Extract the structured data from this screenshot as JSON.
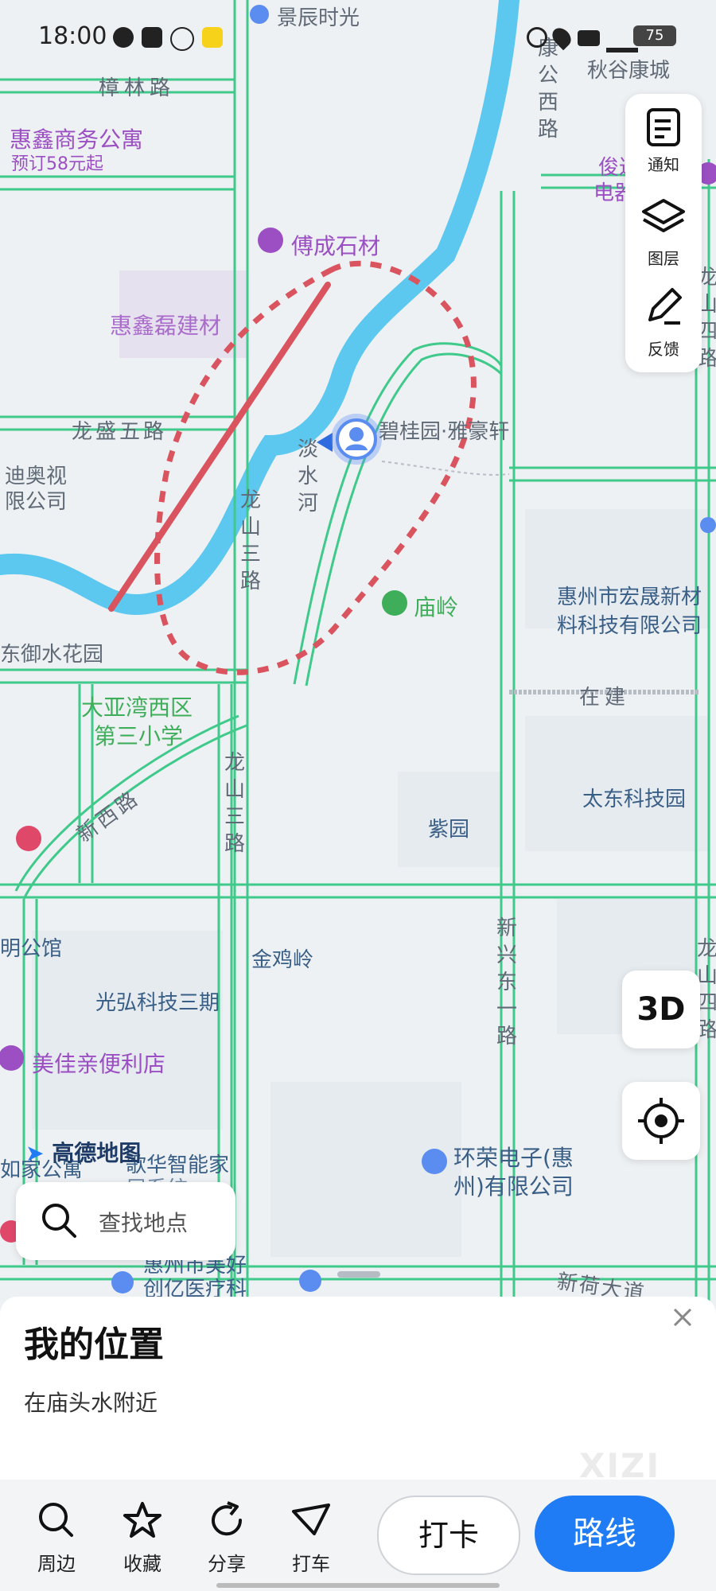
{
  "status_bar": {
    "time": "18:00",
    "battery": "75"
  },
  "map": {
    "labels": {
      "jingchen": "景辰时光",
      "zhanglin": "樟林路",
      "huixin_office": "惠鑫商务公寓",
      "booking": "预订58元起",
      "qiugu": "秋谷康城",
      "fucheng": "傅成石材",
      "huixin_lei": "惠鑫磊建材",
      "longsheng": "龙盛五路",
      "dior": "迪奥视",
      "dior2": "限公司",
      "garden": "碧桂园·雅豪轩",
      "danshui": "淡水河",
      "longshan3": "龙山三路",
      "miaoling": "庙岭",
      "hongsheng": "惠州市宏晟新材",
      "hongsheng2": "料科技有限公司",
      "yuyu": "东御水花园",
      "school1": "大亚湾西区",
      "school2": "第三小学",
      "zaijian": "在建",
      "xinxi": "新西路",
      "taidong": "太东科技园",
      "ziyuan": "紫园",
      "mingguan": "明公馆",
      "jinjiling": "金鸡岭",
      "xinxingdong": "新兴东一路",
      "guanghong": "光弘科技三期",
      "meijia": "美佳亲便利店",
      "huanrong": "环荣电子(惠",
      "huanrong2": "州)有限公司",
      "xinhe": "新荷大道",
      "meihao": "惠州市美好",
      "chuangyi": "创亿医疗科",
      "zhineng": "歌华智能家",
      "zhineng2": "居系统",
      "rujia": "如家公寓",
      "longshan4": "龙山四路",
      "longshan4b": "龙山四路",
      "junda": "俊达",
      "junda2": "电器",
      "kanggong": "康公西路",
      "brand": "高德地图"
    }
  },
  "tools": {
    "notify": "通知",
    "layers": "图层",
    "feedback": "反馈"
  },
  "btn_3d": "3D",
  "search": {
    "placeholder": "查找地点"
  },
  "sheet": {
    "title": "我的位置",
    "subtitle": "在庙头水附近"
  },
  "bottom_actions": {
    "nearby": "周边",
    "favorite": "收藏",
    "share": "分享",
    "taxi": "打车"
  },
  "checkin": "打卡",
  "route": "路线",
  "watermark": "XIZI",
  "colors": {
    "road": "#3fc98a",
    "river": "#5cc8ef",
    "annotation": "#d9545e",
    "accent": "#1f7cf4"
  }
}
